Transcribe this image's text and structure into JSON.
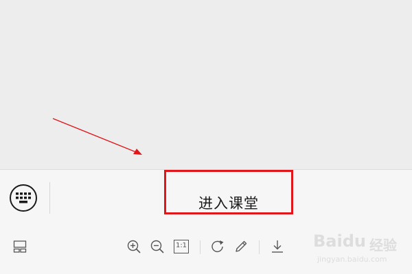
{
  "input_bar": {
    "enter_class_label": "进入课堂"
  },
  "toolbar": {
    "actual_size_label": "1:1"
  },
  "watermark": {
    "brand": "Baidu",
    "cn": "经验",
    "url": "jingyan.baidu.com"
  },
  "colors": {
    "highlight_border": "#e0161b",
    "annotation_arrow": "#e0161b"
  }
}
